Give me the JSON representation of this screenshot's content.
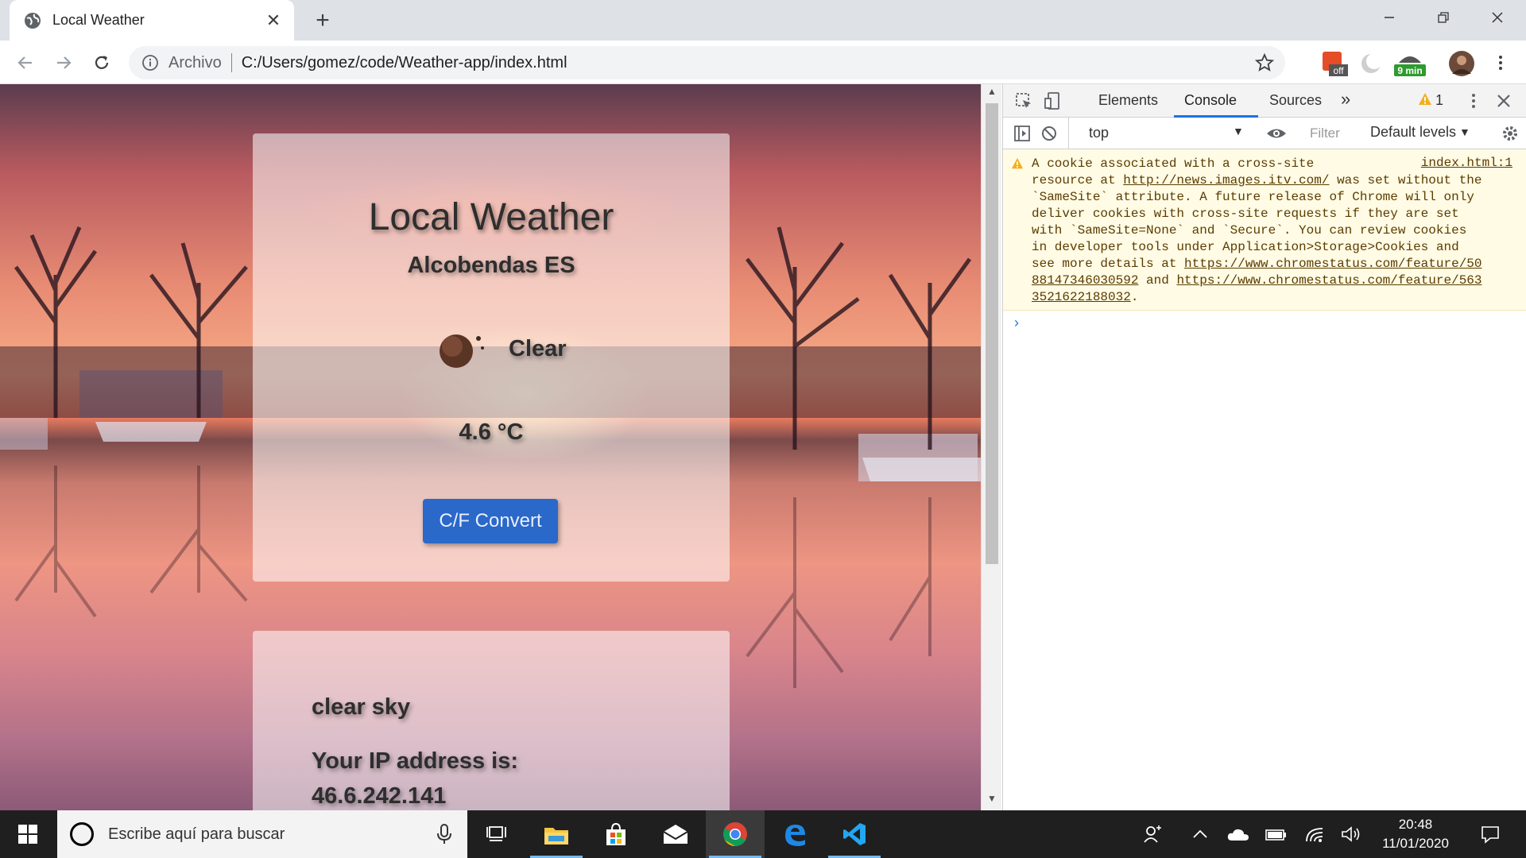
{
  "browser": {
    "tab_title": "Local Weather",
    "new_tab_symbol": "+",
    "close_symbol": "✕",
    "url_scheme_label": "Archivo",
    "url": "C:/Users/gomez/code/Weather-app/index.html",
    "extension_badge_off": "off",
    "extension_badge_timer": "9 min"
  },
  "weather_card": {
    "title": "Local Weather",
    "city": "Alcobendas ES",
    "condition": "Clear",
    "temperature": "4.6 °C",
    "convert_button": "C/F Convert"
  },
  "details_card": {
    "description": "clear sky",
    "ip_label": "Your IP address is:",
    "ip": "46.6.242.141"
  },
  "devtools": {
    "tabs": [
      "Elements",
      "Console",
      "Sources"
    ],
    "more_tabs": "»",
    "warning_count": "1",
    "context": "top",
    "filter_placeholder": "Filter",
    "levels": "Default levels",
    "message_source": "index.html:1",
    "message_line1": "A cookie associated with a cross-site",
    "message_line2a": "resource at ",
    "message_link1": "http://news.images.itv.com/",
    "message_line2b": " was set without the",
    "message_line3": "`SameSite` attribute. A future release of Chrome will only",
    "message_line4": "deliver cookies with cross-site requests if they are set",
    "message_line5": "with `SameSite=None` and `Secure`. You can review cookies",
    "message_line6": "in developer tools under Application>Storage>Cookies and",
    "message_line7a": "see more details at ",
    "message_link2a": "https://www.chromestatus.com/feature/50",
    "message_link2b": "88147346030592",
    "message_line8b": " and ",
    "message_link3a": "https://www.chromestatus.com/feature/563",
    "message_link3b": "3521622188032",
    "message_end": ".",
    "prompt": "›"
  },
  "taskbar": {
    "search_placeholder": "Escribe aquí para buscar",
    "time": "20:48",
    "date": "11/01/2020"
  },
  "colors": {
    "accent": "#1a73e8",
    "button": "#2a68c9",
    "warning_bg": "#fffbe5"
  }
}
